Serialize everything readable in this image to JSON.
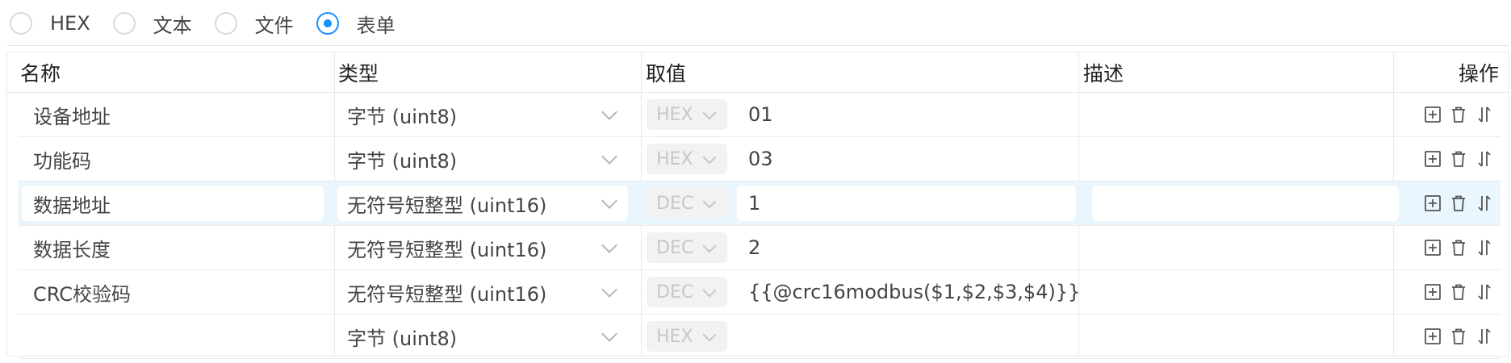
{
  "radio": {
    "options": [
      {
        "label": "HEX",
        "checked": false
      },
      {
        "label": "文本",
        "checked": false
      },
      {
        "label": "文件",
        "checked": false
      },
      {
        "label": "表单",
        "checked": true
      }
    ]
  },
  "table": {
    "headers": {
      "name": "名称",
      "type": "类型",
      "value": "取值",
      "desc": "描述",
      "ops": "操作"
    },
    "rows": [
      {
        "name": "设备地址",
        "type": "字节 (uint8)",
        "format": "HEX",
        "value": "01",
        "desc": "",
        "active": false
      },
      {
        "name": "功能码",
        "type": "字节 (uint8)",
        "format": "HEX",
        "value": "03",
        "desc": "",
        "active": false
      },
      {
        "name": "数据地址",
        "type": "无符号短整型 (uint16)",
        "format": "DEC",
        "value": "1",
        "desc": "",
        "active": true
      },
      {
        "name": "数据长度",
        "type": "无符号短整型 (uint16)",
        "format": "DEC",
        "value": "2",
        "desc": "",
        "active": false
      },
      {
        "name": "CRC校验码",
        "type": "无符号短整型 (uint16)",
        "format": "DEC",
        "value": "{{@crc16modbus($1,$2,$3,$4)}}",
        "desc": "",
        "active": false
      },
      {
        "name": "",
        "type": "字节 (uint8)",
        "format": "HEX",
        "value": "",
        "desc": "",
        "active": false
      }
    ],
    "row_icons": [
      "plus-square-icon",
      "trash-icon",
      "sort-icon"
    ]
  }
}
